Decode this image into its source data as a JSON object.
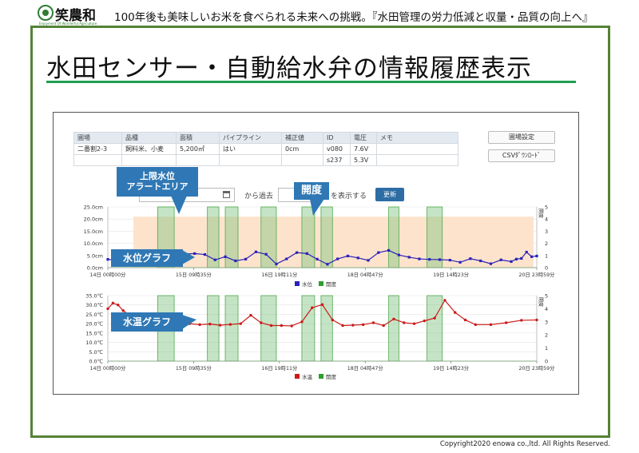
{
  "header": {
    "logo_text": "笑農和",
    "logo_subtext": "Enjoyment Of Wonderful Agriculture",
    "tagline": "100年後も美味しいお米を食べられる未来への挑戦。『水田管理の労力低減と収量・品質の向上へ』"
  },
  "slide": {
    "title": "水田センサー・自動給水弁の情報履歴表示",
    "copyright": "Copyright2020 enowa co.,ltd. All Rights Reserved."
  },
  "info_table": {
    "headers": [
      "圃場",
      "品種",
      "面積",
      "パイプライン",
      "補正値",
      "ID",
      "電圧",
      "メモ"
    ],
    "row": [
      "二番割2-3",
      "飼料米、小麦",
      "5,200㎡",
      "はい",
      "0cm",
      "v080",
      "7.6V",
      ""
    ],
    "row2": [
      "",
      "",
      "",
      "",
      "",
      "s237",
      "5.3V",
      ""
    ]
  },
  "buttons": {
    "field_settings": "圃場設定",
    "csv_download": "CSVﾀﾞｳﾝﾛｰﾄﾞ",
    "update": "更新"
  },
  "controls": {
    "from_label": "から過去",
    "show_label": "を表示する"
  },
  "callouts": {
    "alert_area": "上限水位\nアラートエリア",
    "valve_open": "開度",
    "water_level_graph": "水位グラフ",
    "water_temp_graph": "水温グラフ"
  },
  "chart_data": [
    {
      "type": "line",
      "title": "",
      "y_ticks": [
        "0.0cm",
        "5.0cm",
        "10.0cm",
        "15.0cm",
        "20.0cm",
        "25.0cm"
      ],
      "ylim": [
        0,
        25
      ],
      "y2_label": "開度",
      "y2_ticks": [
        "0",
        "1",
        "2",
        "3",
        "4",
        "5"
      ],
      "y2lim": [
        0,
        5
      ],
      "x_ticks": [
        "14日 00時00分",
        "15日 09時35分",
        "16日 19時11分",
        "18日 04時47分",
        "19日 14時23分",
        "20日 23時59分"
      ],
      "xlim": [
        0,
        168
      ],
      "x_tick_values": [
        0,
        33.6,
        67.2,
        100.8,
        134.4,
        168
      ],
      "legend": [
        "水位",
        "開度"
      ],
      "alert_band": [
        0,
        21
      ],
      "valve_open_intervals": [
        [
          19.5,
          26
        ],
        [
          39,
          43.5
        ],
        [
          46,
          51
        ],
        [
          60,
          66
        ],
        [
          76,
          81
        ],
        [
          83.5,
          88
        ],
        [
          110,
          114
        ],
        [
          125,
          131
        ]
      ],
      "valve_open_value": 5,
      "series": [
        {
          "name": "水位",
          "x": [
            0,
            6,
            12,
            18,
            22,
            26,
            30,
            34,
            38,
            42,
            46,
            50,
            54,
            58,
            62,
            66,
            70,
            74,
            78,
            82,
            86,
            90,
            94,
            98,
            102,
            106,
            110,
            114,
            118,
            122,
            126,
            130,
            134,
            138,
            142,
            146,
            150,
            154,
            158,
            160,
            162,
            164,
            166,
            168
          ],
          "y": [
            3.4,
            2.8,
            2.4,
            3,
            3.3,
            3.8,
            5.6,
            5.8,
            5.4,
            3.2,
            4.5,
            2.8,
            3.5,
            6.5,
            5.5,
            1.5,
            3.6,
            6.2,
            5.8,
            3.5,
            1.4,
            3.6,
            4.8,
            4,
            3,
            6.2,
            7.1,
            5.2,
            4.3,
            3.6,
            3.4,
            3.3,
            3.1,
            2.2,
            3.7,
            2.8,
            1.6,
            3.2,
            2.5,
            3.5,
            3.8,
            6.4,
            4.5,
            4.8
          ]
        }
      ]
    },
    {
      "type": "line",
      "title": "",
      "y_ticks": [
        "0.0℃",
        "5.0℃",
        "10.0℃",
        "15.0℃",
        "20.0℃",
        "25.0℃",
        "30.0℃",
        "35.0℃"
      ],
      "ylim": [
        0,
        35
      ],
      "y2_label": "開度",
      "y2_ticks": [
        "0",
        "1",
        "2",
        "3",
        "4",
        "5"
      ],
      "y2lim": [
        0,
        5
      ],
      "x_ticks": [
        "14日 00時00分",
        "15日 09時35分",
        "16日 19時11分",
        "18日 04時47分",
        "19日 14時23分",
        "20日 23時59分"
      ],
      "xlim": [
        0,
        168
      ],
      "x_tick_values": [
        0,
        33.6,
        67.2,
        100.8,
        134.4,
        168
      ],
      "legend": [
        "水温",
        "開度"
      ],
      "valve_open_intervals": [
        [
          19.5,
          26
        ],
        [
          39,
          43.5
        ],
        [
          46,
          51
        ],
        [
          60,
          66
        ],
        [
          76,
          81
        ],
        [
          83.5,
          88
        ],
        [
          110,
          114
        ],
        [
          125,
          131
        ]
      ],
      "valve_open_value": 5,
      "series": [
        {
          "name": "水温",
          "x": [
            0,
            2,
            4,
            6,
            8,
            10,
            13,
            16,
            20,
            24,
            28,
            32,
            36,
            40,
            44,
            48,
            52,
            56,
            60,
            64,
            68,
            72,
            76,
            80,
            84,
            88,
            92,
            96,
            100,
            104,
            108,
            112,
            116,
            120,
            124,
            128,
            132,
            136,
            140,
            144,
            150,
            156,
            162,
            168
          ],
          "y": [
            28,
            31,
            30,
            27,
            25,
            22,
            21,
            22,
            21,
            22.5,
            22,
            20,
            19.5,
            19.8,
            19.2,
            19.6,
            20,
            24.5,
            20.5,
            19,
            19,
            18.8,
            21,
            28.5,
            30.2,
            22,
            19,
            19.2,
            19.5,
            20.5,
            19,
            22.5,
            20.5,
            20,
            21.5,
            23,
            32.5,
            26,
            22,
            19.5,
            19.5,
            20.5,
            21.8,
            22
          ]
        }
      ]
    }
  ]
}
